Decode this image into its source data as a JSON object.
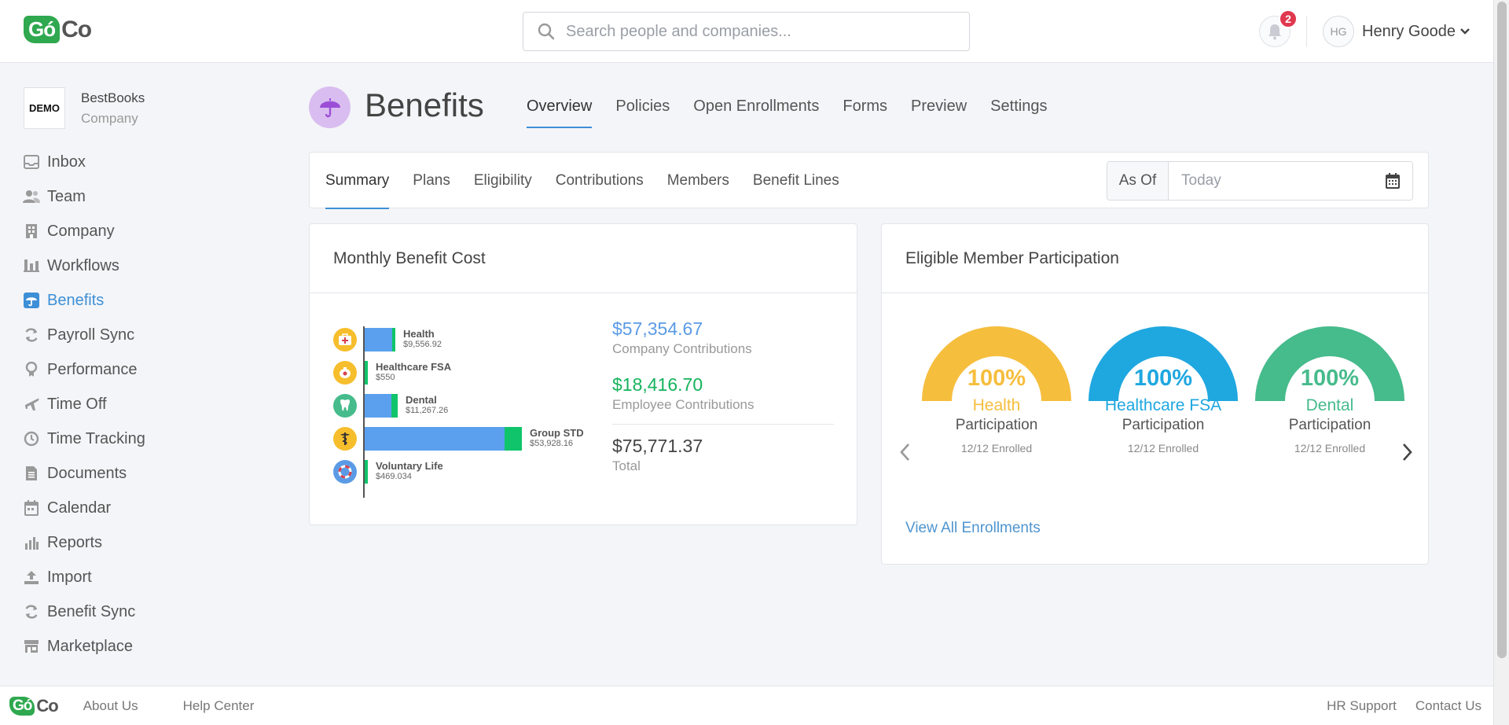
{
  "brand": {
    "logo_left": "Gó",
    "logo_right": "Co"
  },
  "search": {
    "placeholder": "Search people and companies..."
  },
  "notifications": {
    "count": "2"
  },
  "user": {
    "initials": "HG",
    "name": "Henry Goode"
  },
  "company": {
    "badge": "DEMO",
    "name": "BestBooks",
    "type": "Company"
  },
  "sidebar": {
    "items": [
      {
        "label": "Inbox",
        "icon": "inbox-icon"
      },
      {
        "label": "Team",
        "icon": "team-icon"
      },
      {
        "label": "Company",
        "icon": "building-icon"
      },
      {
        "label": "Workflows",
        "icon": "workflow-icon"
      },
      {
        "label": "Benefits",
        "icon": "umbrella-icon",
        "active": true
      },
      {
        "label": "Payroll Sync",
        "icon": "sync-icon"
      },
      {
        "label": "Performance",
        "icon": "award-icon"
      },
      {
        "label": "Time Off",
        "icon": "plane-icon"
      },
      {
        "label": "Time Tracking",
        "icon": "clock-icon"
      },
      {
        "label": "Documents",
        "icon": "document-icon"
      },
      {
        "label": "Calendar",
        "icon": "calendar-icon"
      },
      {
        "label": "Reports",
        "icon": "bar-chart-icon"
      },
      {
        "label": "Import",
        "icon": "upload-icon"
      },
      {
        "label": "Benefit Sync",
        "icon": "sync-icon"
      },
      {
        "label": "Marketplace",
        "icon": "store-icon"
      }
    ]
  },
  "page": {
    "title": "Benefits",
    "tabs": [
      "Overview",
      "Policies",
      "Open Enrollments",
      "Forms",
      "Preview",
      "Settings"
    ],
    "active_tab": "Overview",
    "subtabs": [
      "Summary",
      "Plans",
      "Eligibility",
      "Contributions",
      "Members",
      "Benefit Lines"
    ],
    "active_subtab": "Summary",
    "as_of_label": "As Of",
    "as_of_placeholder": "Today"
  },
  "cost_card": {
    "title": "Monthly Benefit Cost",
    "lines": [
      {
        "name": "Health",
        "value": "$9,556.92",
        "company_amt": 9556.92,
        "icon": "medical-kit-icon",
        "icon_color": "#f6be2c"
      },
      {
        "name": "Healthcare FSA",
        "value": "$550",
        "company_amt": 0,
        "icon": "piggy-bank-icon",
        "icon_color": "#f6be2c"
      },
      {
        "name": "Dental",
        "value": "$11,267.26",
        "company_amt": 9000,
        "icon": "tooth-icon",
        "icon_color": "#46bb8c"
      },
      {
        "name": "Group STD",
        "value": "$53,928.16",
        "company_amt": 48000,
        "icon": "medical-symbol-icon",
        "icon_color": "#f6be2c"
      },
      {
        "name": "Voluntary Life",
        "value": "$469.034",
        "company_amt": 0,
        "icon": "lifebuoy-icon",
        "icon_color": "#5b9be6"
      }
    ],
    "colors": {
      "company": "#5aa0ee",
      "employee": "#0fc46a"
    },
    "company_total": "$57,354.67",
    "company_label": "Company Contributions",
    "employee_total": "$18,416.70",
    "employee_label": "Employee Contributions",
    "grand_total": "$75,771.37",
    "grand_label": "Total"
  },
  "participation_card": {
    "title": "Eligible Member Participation",
    "gauges": [
      {
        "pct": "100%",
        "name": "Health",
        "sub": "Participation",
        "enrolled": "12/12 Enrolled",
        "color": "#f6be3d",
        "value": 100
      },
      {
        "pct": "100%",
        "name": "Healthcare FSA",
        "sub": "Participation",
        "enrolled": "12/12 Enrolled",
        "color": "#1fa7e0",
        "value": 100
      },
      {
        "pct": "100%",
        "name": "Dental",
        "sub": "Participation",
        "enrolled": "12/12 Enrolled",
        "color": "#46bb8c",
        "value": 100
      }
    ],
    "view_all": "View All Enrollments"
  },
  "footer": {
    "about": "About Us",
    "help": "Help Center",
    "hr_support": "HR Support",
    "contact": "Contact Us"
  }
}
